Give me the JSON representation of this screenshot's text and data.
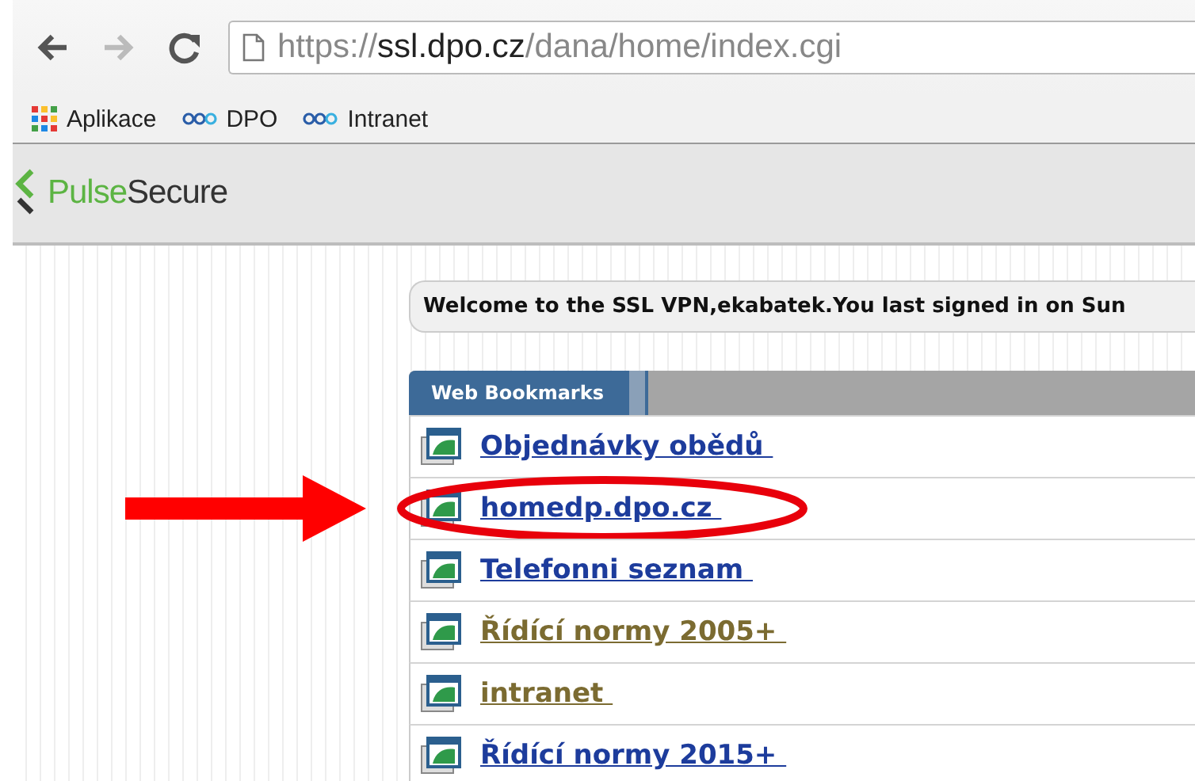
{
  "browser": {
    "url": {
      "scheme": "https://",
      "host": "ssl.dpo.cz",
      "path": "/dana/home/index.cgi"
    },
    "forward_disabled": true,
    "bookmarks_bar": [
      {
        "label": "Aplikace",
        "kind": "apps"
      },
      {
        "label": "DPO",
        "kind": "site"
      },
      {
        "label": "Intranet",
        "kind": "site"
      }
    ]
  },
  "header": {
    "brand_primary": "Pulse",
    "brand_secondary": "Secure"
  },
  "welcome": "Welcome to the SSL VPN,ekabatek.You last signed in on  Sun",
  "panel": {
    "tab": "Web Bookmarks",
    "bookmarks": [
      {
        "label": "Objednávky obědů ",
        "visited": false,
        "highlighted": false
      },
      {
        "label": "homedp.dpo.cz ",
        "visited": false,
        "highlighted": true
      },
      {
        "label": "Telefonni seznam ",
        "visited": false,
        "highlighted": false
      },
      {
        "label": "Řídící normy 2005+ ",
        "visited": true,
        "highlighted": false
      },
      {
        "label": "intranet ",
        "visited": true,
        "highlighted": false
      },
      {
        "label": "Řídící normy 2015+ ",
        "visited": false,
        "highlighted": false
      }
    ]
  }
}
